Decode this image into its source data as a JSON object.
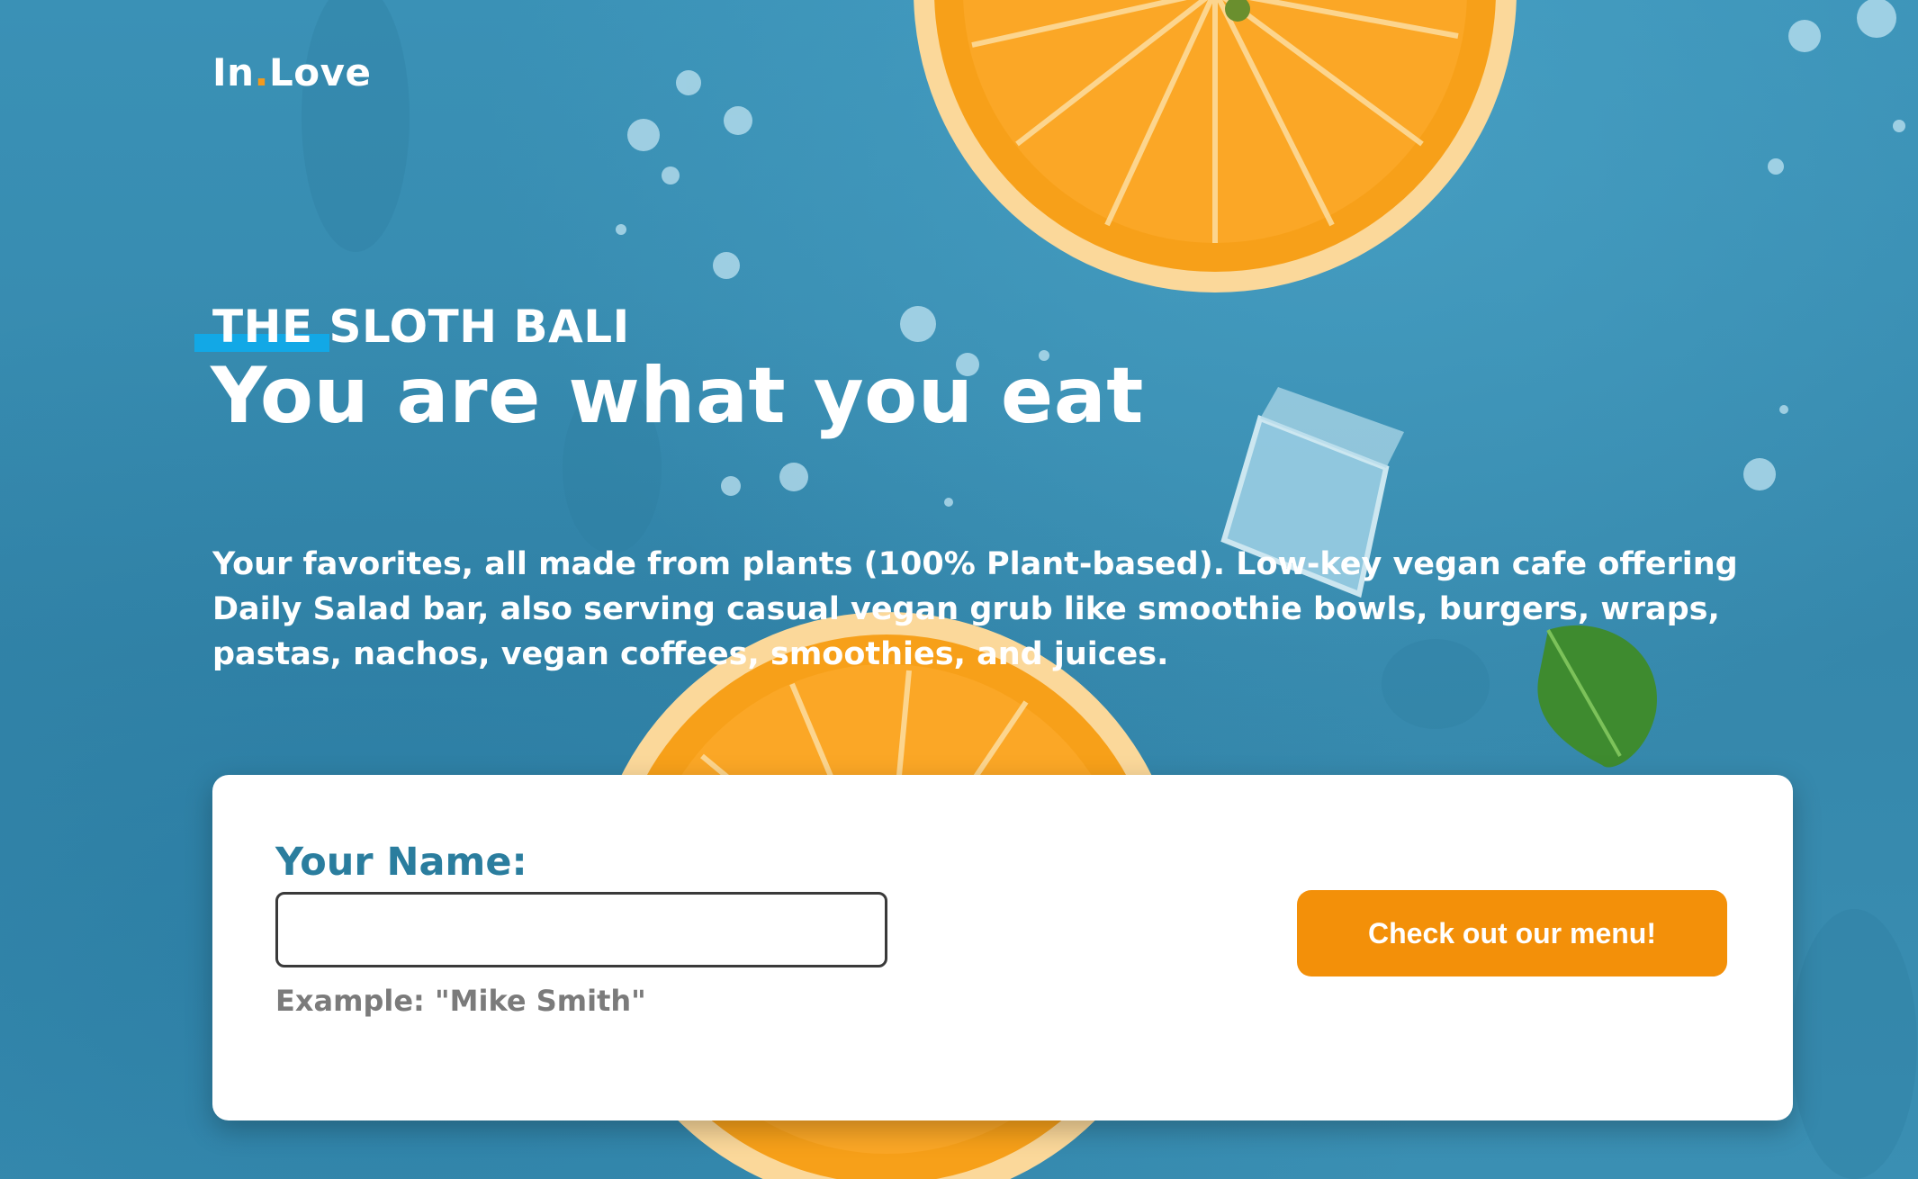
{
  "brand": {
    "name_part1": "In",
    "dot": ".",
    "name_part2": "Love",
    "accent_color": "#f39a1d"
  },
  "hero": {
    "eyebrow": "THE SLOTH BALI",
    "headline": "You are what you eat",
    "description": "Your favorites, all made from plants (100% Plant-based). Low-key vegan cafe offering Daily Salad bar, also serving casual vegan grub like smoothie bowls, burgers, wraps, pastas, nachos, vegan coffees, smoothies, and juices."
  },
  "form": {
    "name_label": "Your Name:",
    "name_value": "",
    "name_hint": "Example: \"Mike Smith\"",
    "submit_label": "Check out our menu!",
    "button_color": "#f39009"
  },
  "colors": {
    "background": "#3a8fb3",
    "label": "#2a7d9e",
    "highlight_bar": "#12a8e6"
  }
}
